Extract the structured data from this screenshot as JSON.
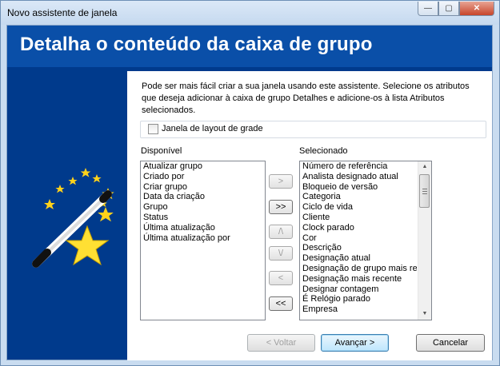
{
  "window": {
    "title": "Novo assistente de janela",
    "controls": {
      "minimize": "—",
      "maximize": "▢",
      "close": "✕"
    }
  },
  "header": {
    "title": "Detalha o conteúdo da caixa de grupo"
  },
  "description": "Pode ser mais fácil criar a sua janela usando este assistente. Selecione os atributos que deseja adicionar à caixa de grupo Detalhes e adicione-os à lista Atributos selecionados.",
  "grid_layout": {
    "label": "Janela de layout de grade",
    "checked": false
  },
  "available": {
    "label": "Disponível",
    "items": [
      "Atualizar grupo",
      "Criado por",
      "Criar grupo",
      "Data da criação",
      "Grupo",
      "Status",
      "Última atualização",
      "Última atualização por"
    ]
  },
  "selected": {
    "label": "Selecionado",
    "items": [
      "Número de referência",
      "Analista designado atual",
      "Bloqueio de versão",
      "Categoria",
      "Ciclo de vida",
      "Cliente",
      "Clock parado",
      "Cor",
      "Descrição",
      "Designação atual",
      "Designação de grupo mais recente",
      "Designação mais recente",
      "Designar contagem",
      "É Relógio parado",
      "Empresa"
    ]
  },
  "move_buttons": {
    "add": ">",
    "add_all": ">>",
    "move_up": "/\\",
    "move_down": "\\/",
    "remove": "<",
    "remove_all": "<<"
  },
  "footer": {
    "back": "< Voltar",
    "next": "Avançar >",
    "cancel": "Cancelar"
  },
  "icons": {
    "wand": "magic-wand-icon",
    "star": "star-icon"
  },
  "colors": {
    "header_bg": "#0a4fa8",
    "side_bg": "#003a8c",
    "close_btn": "#c7452b"
  }
}
